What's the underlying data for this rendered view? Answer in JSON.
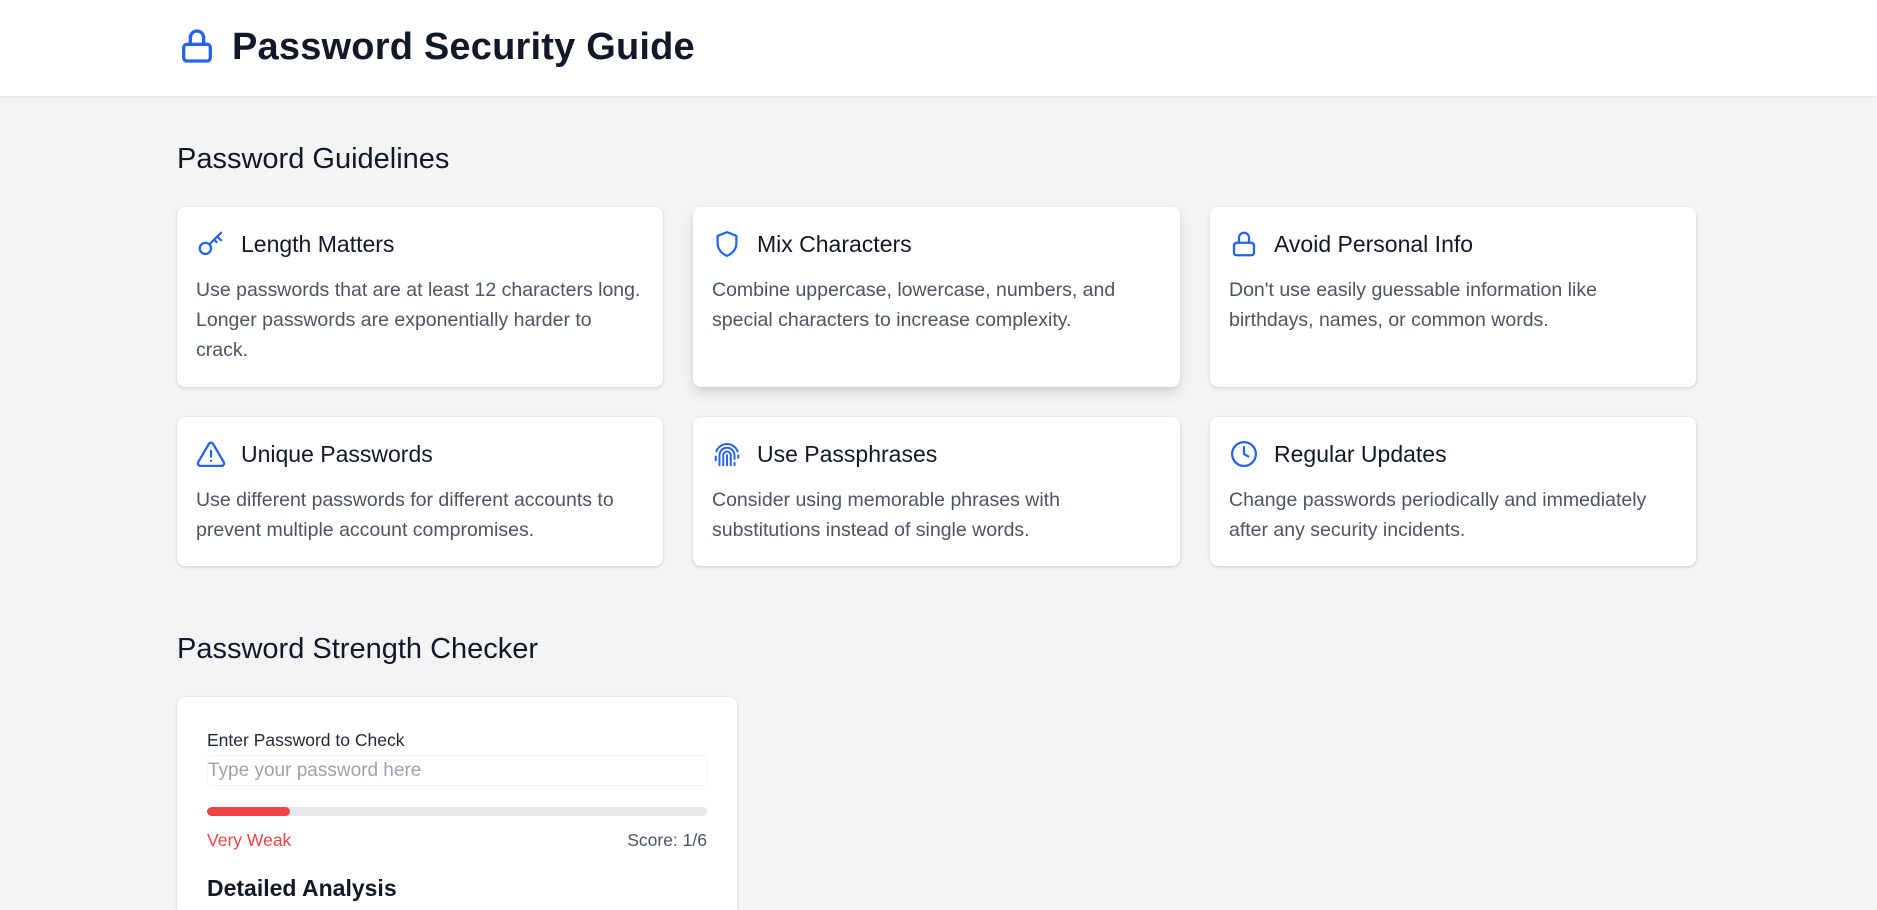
{
  "header": {
    "title": "Password Security Guide",
    "icon": "lock-icon",
    "accent_color": "#2563eb"
  },
  "guidelines": {
    "section_title": "Password Guidelines",
    "cards": [
      {
        "icon": "key-icon",
        "title": "Length Matters",
        "text": "Use passwords that are at least 12 characters long. Longer passwords are exponentially harder to crack."
      },
      {
        "icon": "shield-icon",
        "title": "Mix Characters",
        "text": "Combine uppercase, lowercase, numbers, and special characters to increase complexity."
      },
      {
        "icon": "lock-icon",
        "title": "Avoid Personal Info",
        "text": "Don't use easily guessable information like birthdays, names, or common words."
      },
      {
        "icon": "warning-triangle-icon",
        "title": "Unique Passwords",
        "text": "Use different passwords for different accounts to prevent multiple account compromises."
      },
      {
        "icon": "fingerprint-icon",
        "title": "Use Passphrases",
        "text": "Consider using memorable phrases with substitutions instead of single words."
      },
      {
        "icon": "clock-icon",
        "title": "Regular Updates",
        "text": "Change passwords periodically and immediately after any security incidents."
      }
    ]
  },
  "checker": {
    "section_title": "Password Strength Checker",
    "input_label": "Enter Password to Check",
    "input_placeholder": "Type your password here",
    "input_value": "",
    "strength_text": "Very Weak",
    "strength_color": "#ef4444",
    "score_text": "Score: 1/6",
    "score_fraction": 0.1667,
    "analysis_title": "Detailed Analysis"
  }
}
